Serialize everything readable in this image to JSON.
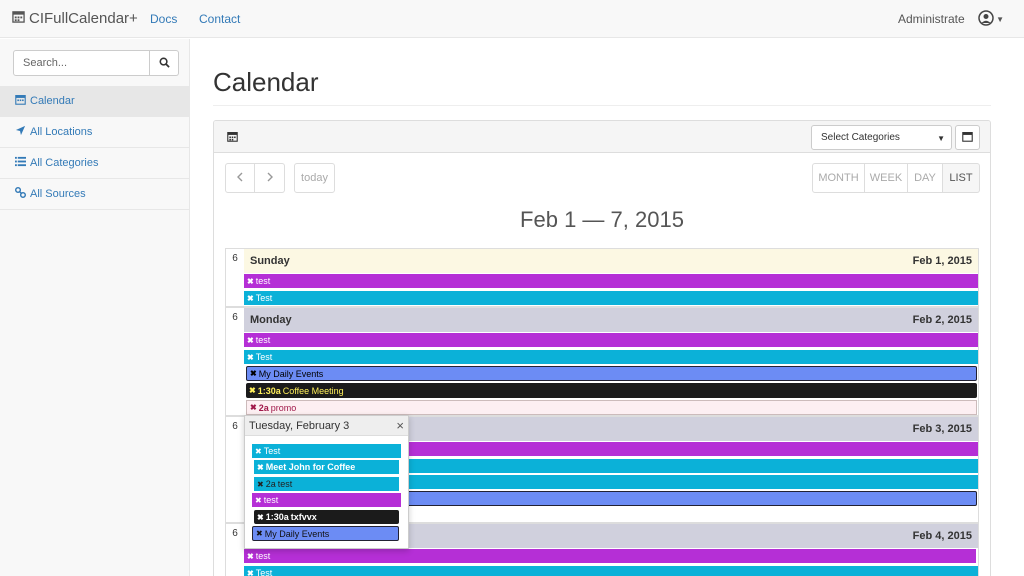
{
  "navbar": {
    "brand": "CIFullCalendar+",
    "links": [
      "Docs",
      "Contact"
    ],
    "admin": "Administrate"
  },
  "sidebar": {
    "search_placeholder": "Search...",
    "items": [
      {
        "label": "Calendar",
        "icon": "calendar-icon"
      },
      {
        "label": "All Locations",
        "icon": "location-arrow-icon"
      },
      {
        "label": "All Categories",
        "icon": "list-icon"
      },
      {
        "label": "All Sources",
        "icon": "link-icon"
      }
    ]
  },
  "main": {
    "title": "Calendar",
    "select_categories": "Select Categories",
    "toolbar": {
      "today": "today",
      "views": [
        "MONTH",
        "WEEK",
        "DAY",
        "LIST"
      ],
      "active_view": "LIST"
    },
    "range_title": "Feb 1 — 7, 2015"
  },
  "days": [
    {
      "num": "6",
      "name": "Sunday",
      "date": "Feb 1, 2015",
      "events": [
        {
          "label": "test",
          "color": "#b52fd6"
        },
        {
          "label": "Test",
          "color": "#0bb1d8"
        }
      ]
    },
    {
      "num": "6",
      "name": "Monday",
      "date": "Feb 2, 2015",
      "events": [
        {
          "label": "test",
          "color": "#b52fd6"
        },
        {
          "label": "Test",
          "color": "#0bb1d8"
        },
        {
          "label": "My Daily Events",
          "color": "#6c8cf4"
        },
        {
          "time": "1:30a",
          "label": "Coffee Meeting",
          "color": "#1b1b1b"
        },
        {
          "time": "2a",
          "label": "promo",
          "color": "#fdeff2"
        }
      ]
    },
    {
      "num": "6",
      "name": "",
      "date": "Feb 3, 2015",
      "events": []
    },
    {
      "num": "6",
      "name": "",
      "date": "Feb 4, 2015",
      "events": [
        {
          "label": "test",
          "color": "#b52fd6"
        },
        {
          "label": "Test",
          "color": "#0bb1d8"
        }
      ]
    }
  ],
  "popover": {
    "title": "Tuesday, February 3",
    "events": [
      {
        "label": "Test",
        "color": "#0bb1d8"
      },
      {
        "label": "Meet John for Coffee",
        "color": "#0bb1d8"
      },
      {
        "time": "2a",
        "label": "test",
        "color": "#0bb1d8"
      },
      {
        "label": "test",
        "color": "#b52fd6"
      },
      {
        "time": "1:30a",
        "label": "txfvvx",
        "color": "#1b1b1b"
      },
      {
        "label": "My Daily Events",
        "color": "#6c8cf4"
      }
    ]
  }
}
